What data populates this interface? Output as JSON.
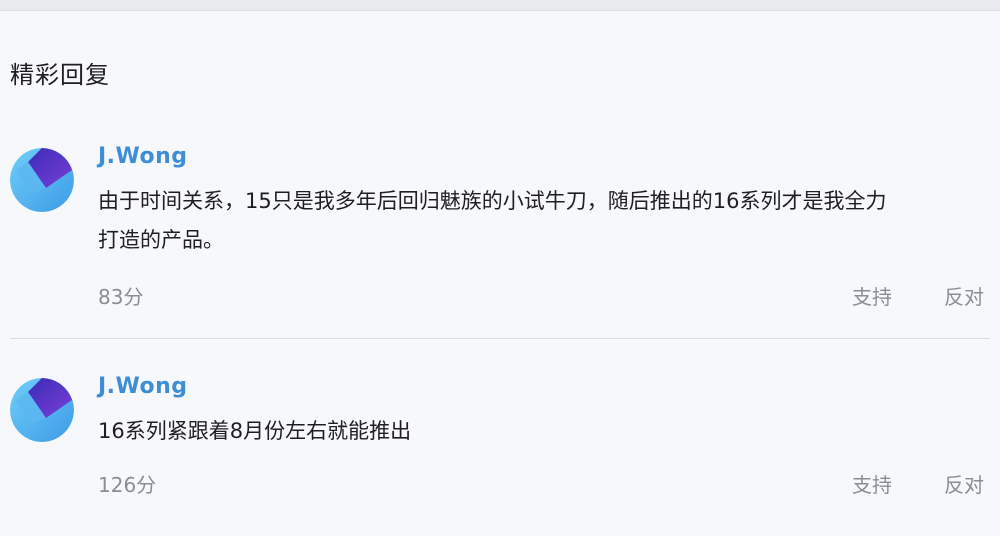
{
  "section_title": "精彩回复",
  "comments": [
    {
      "author": "J.Wong",
      "avatar_icon": "flyme-logo-icon",
      "text_line1": "由于时间关系，15只是我多年后回归魅族的小试牛刀，随后推出的16系列才是我全力",
      "text_line2": "打造的产品。",
      "score": "83分",
      "support_label": "支持",
      "oppose_label": "反对"
    },
    {
      "author": "J.Wong",
      "avatar_icon": "flyme-logo-icon",
      "text_line1": "16系列紧跟着8月份左右就能推出",
      "score": "126分",
      "support_label": "支持",
      "oppose_label": "反对"
    }
  ],
  "colors": {
    "author": "#3d8ed6",
    "muted": "#8b8d93",
    "background": "#f7f8fc",
    "avatar_purple": "#5a2fc4",
    "avatar_blue": "#4fb0ee"
  }
}
